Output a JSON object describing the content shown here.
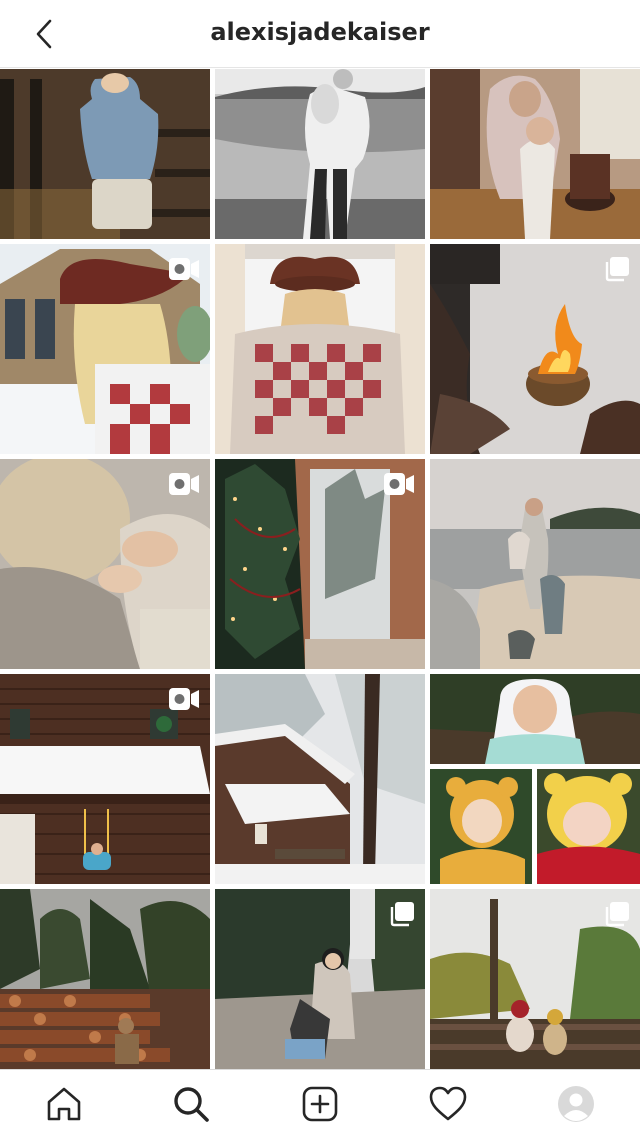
{
  "header": {
    "username": "alexisjadekaiser",
    "back_icon": "chevron-left-icon"
  },
  "grid": {
    "badges": {
      "r2c1": "reel-icon",
      "r2c3": "multiple-posts-icon",
      "r3c1": "reel-icon",
      "r3c2": "reel-icon",
      "r4c1": "reel-icon",
      "r5c2": "multiple-posts-icon",
      "r5c3": "multiple-posts-icon"
    }
  },
  "tabbar": {
    "items": [
      {
        "name": "home",
        "icon": "home-icon"
      },
      {
        "name": "search",
        "icon": "search-icon",
        "active": true
      },
      {
        "name": "new-post",
        "icon": "plus-square-icon"
      },
      {
        "name": "activity",
        "icon": "heart-icon"
      },
      {
        "name": "profile",
        "icon": "avatar-icon"
      }
    ]
  }
}
